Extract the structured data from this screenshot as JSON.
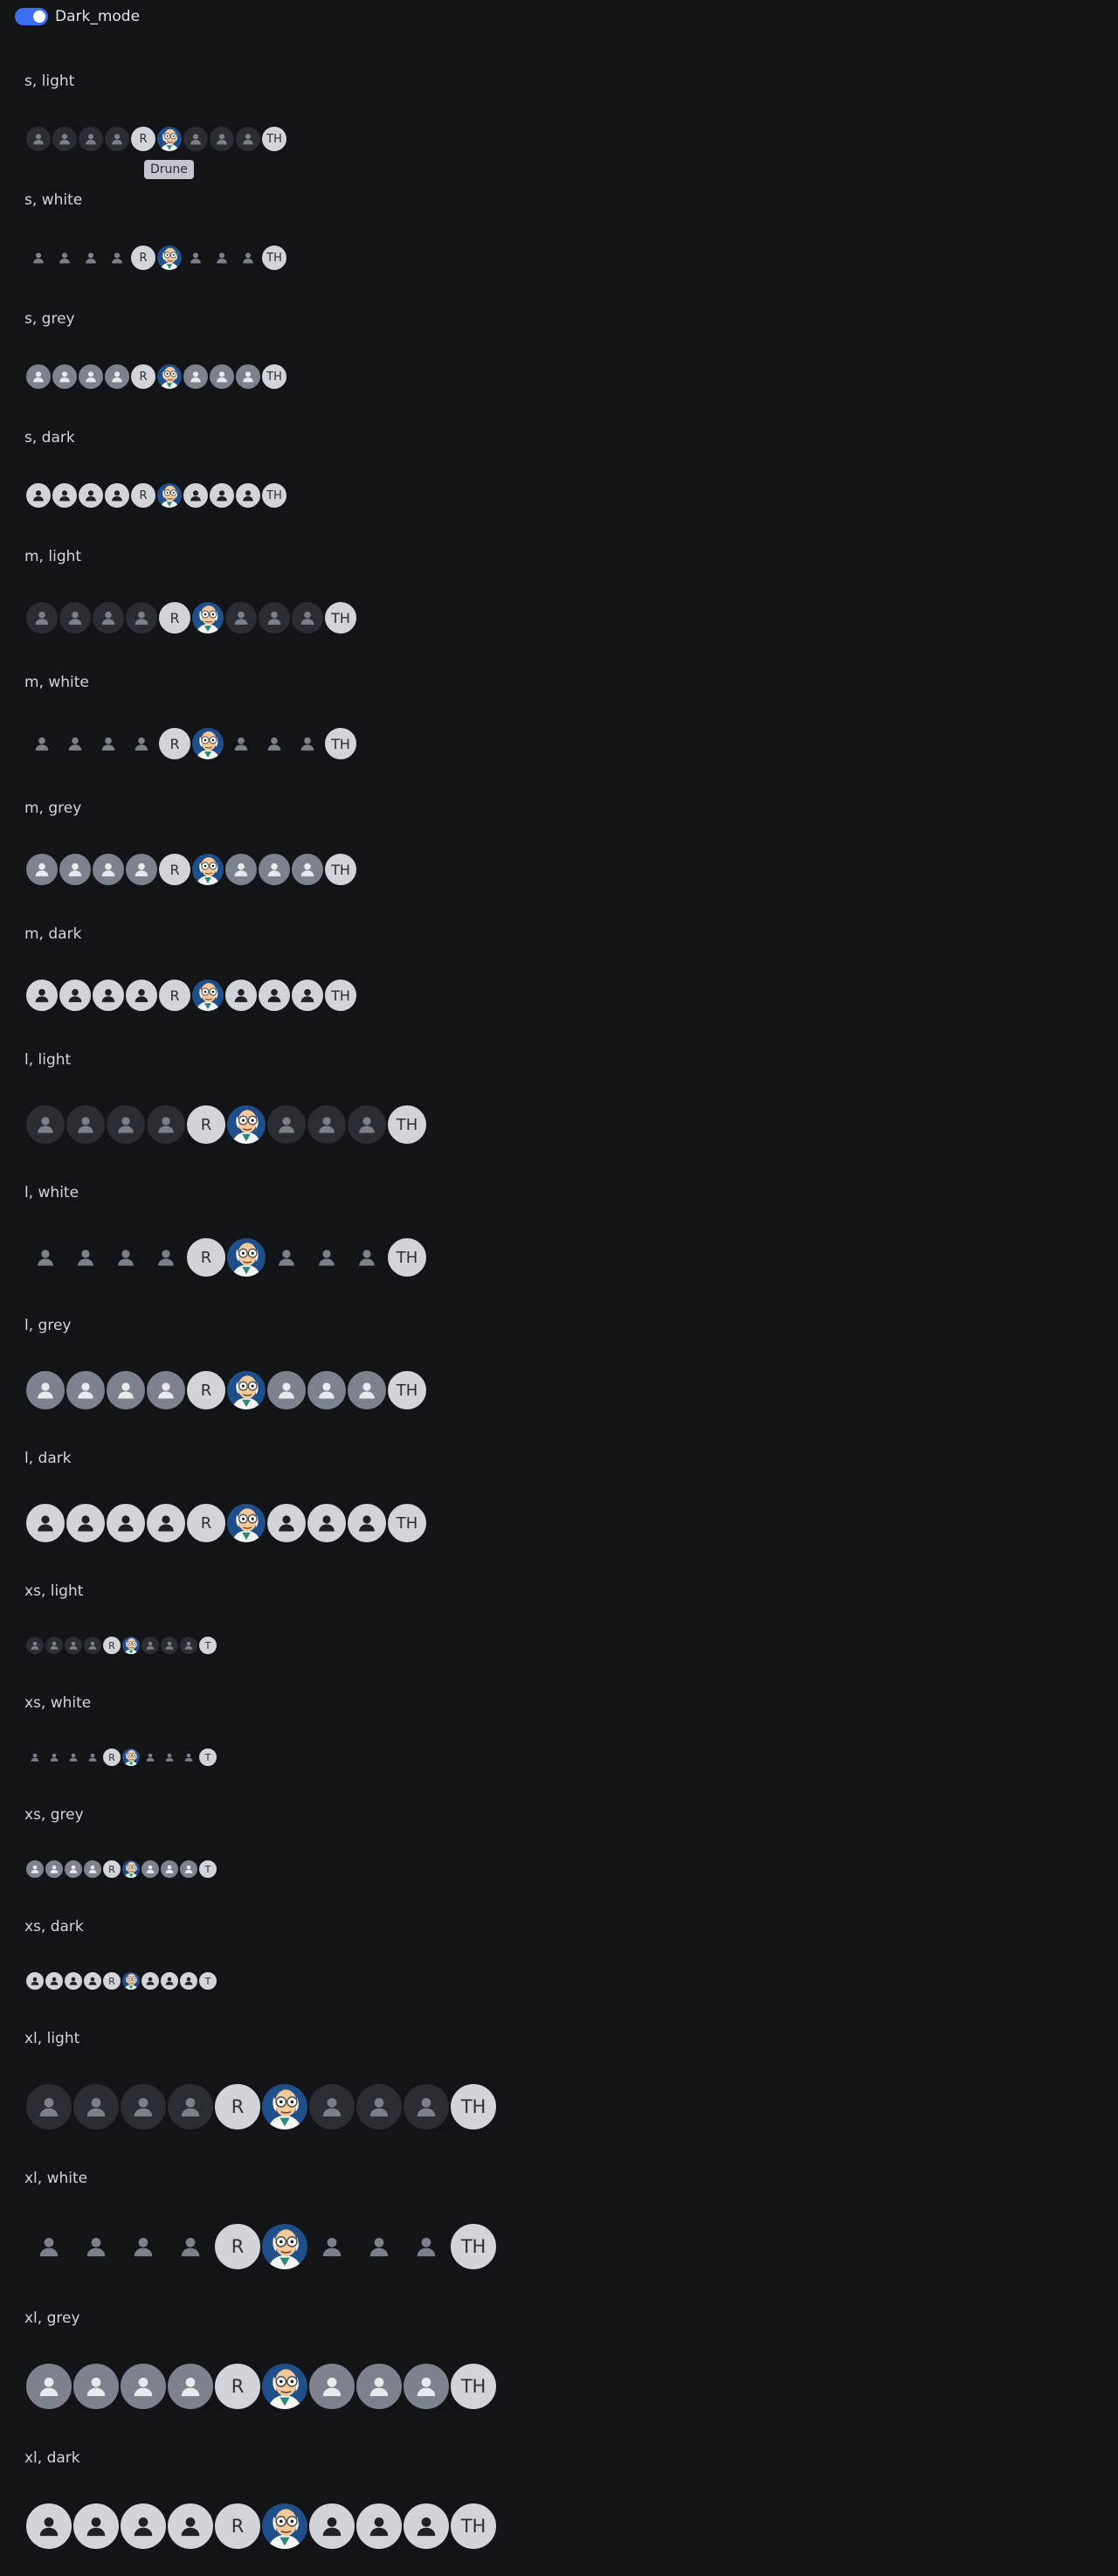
{
  "header": {
    "toggle_label": "Dark_mode",
    "toggle_on": true,
    "toggle_color": "#3c6ef5"
  },
  "tooltip": {
    "text": "Drune"
  },
  "avatars": [
    {
      "kind": "person"
    },
    {
      "kind": "person"
    },
    {
      "kind": "person"
    },
    {
      "kind": "person"
    },
    {
      "kind": "initials",
      "text": "R"
    },
    {
      "kind": "image",
      "name": "professor-farnsworth-image"
    },
    {
      "kind": "person"
    },
    {
      "kind": "person"
    },
    {
      "kind": "person"
    },
    {
      "kind": "initials",
      "text": "TH"
    }
  ],
  "avatars_xs_last": "T",
  "variants": {
    "light": {
      "bg": "#2b2d33",
      "icon": "#7c8089"
    },
    "white": {
      "bg": "transparent",
      "icon": "#7c8089"
    },
    "grey": {
      "bg": "#7e828c",
      "icon": "#e9eaee"
    },
    "dark": {
      "bg": "#d2d4d9",
      "icon": "#1f2126"
    }
  },
  "initials_bg": "#d2d4d9",
  "sections": [
    {
      "label": "s, light",
      "size": "s",
      "variant": "light"
    },
    {
      "label": "s, white",
      "size": "s",
      "variant": "white"
    },
    {
      "label": "s, grey",
      "size": "s",
      "variant": "grey"
    },
    {
      "label": "s, dark",
      "size": "s",
      "variant": "dark"
    },
    {
      "label": "m, light",
      "size": "m",
      "variant": "light"
    },
    {
      "label": "m, white",
      "size": "m",
      "variant": "white"
    },
    {
      "label": "m, grey",
      "size": "m",
      "variant": "grey"
    },
    {
      "label": "m, dark",
      "size": "m",
      "variant": "dark"
    },
    {
      "label": "l, light",
      "size": "l",
      "variant": "light"
    },
    {
      "label": "l, white",
      "size": "l",
      "variant": "white"
    },
    {
      "label": "l, grey",
      "size": "l",
      "variant": "grey"
    },
    {
      "label": "l, dark",
      "size": "l",
      "variant": "dark"
    },
    {
      "label": "xs, light",
      "size": "xs",
      "variant": "light"
    },
    {
      "label": "xs, white",
      "size": "xs",
      "variant": "white"
    },
    {
      "label": "xs, grey",
      "size": "xs",
      "variant": "grey"
    },
    {
      "label": "xs, dark",
      "size": "xs",
      "variant": "dark"
    },
    {
      "label": "xl, light",
      "size": "xl",
      "variant": "light"
    },
    {
      "label": "xl, white",
      "size": "xl",
      "variant": "white"
    },
    {
      "label": "xl, grey",
      "size": "xl",
      "variant": "grey"
    },
    {
      "label": "xl, dark",
      "size": "xl",
      "variant": "dark"
    }
  ]
}
